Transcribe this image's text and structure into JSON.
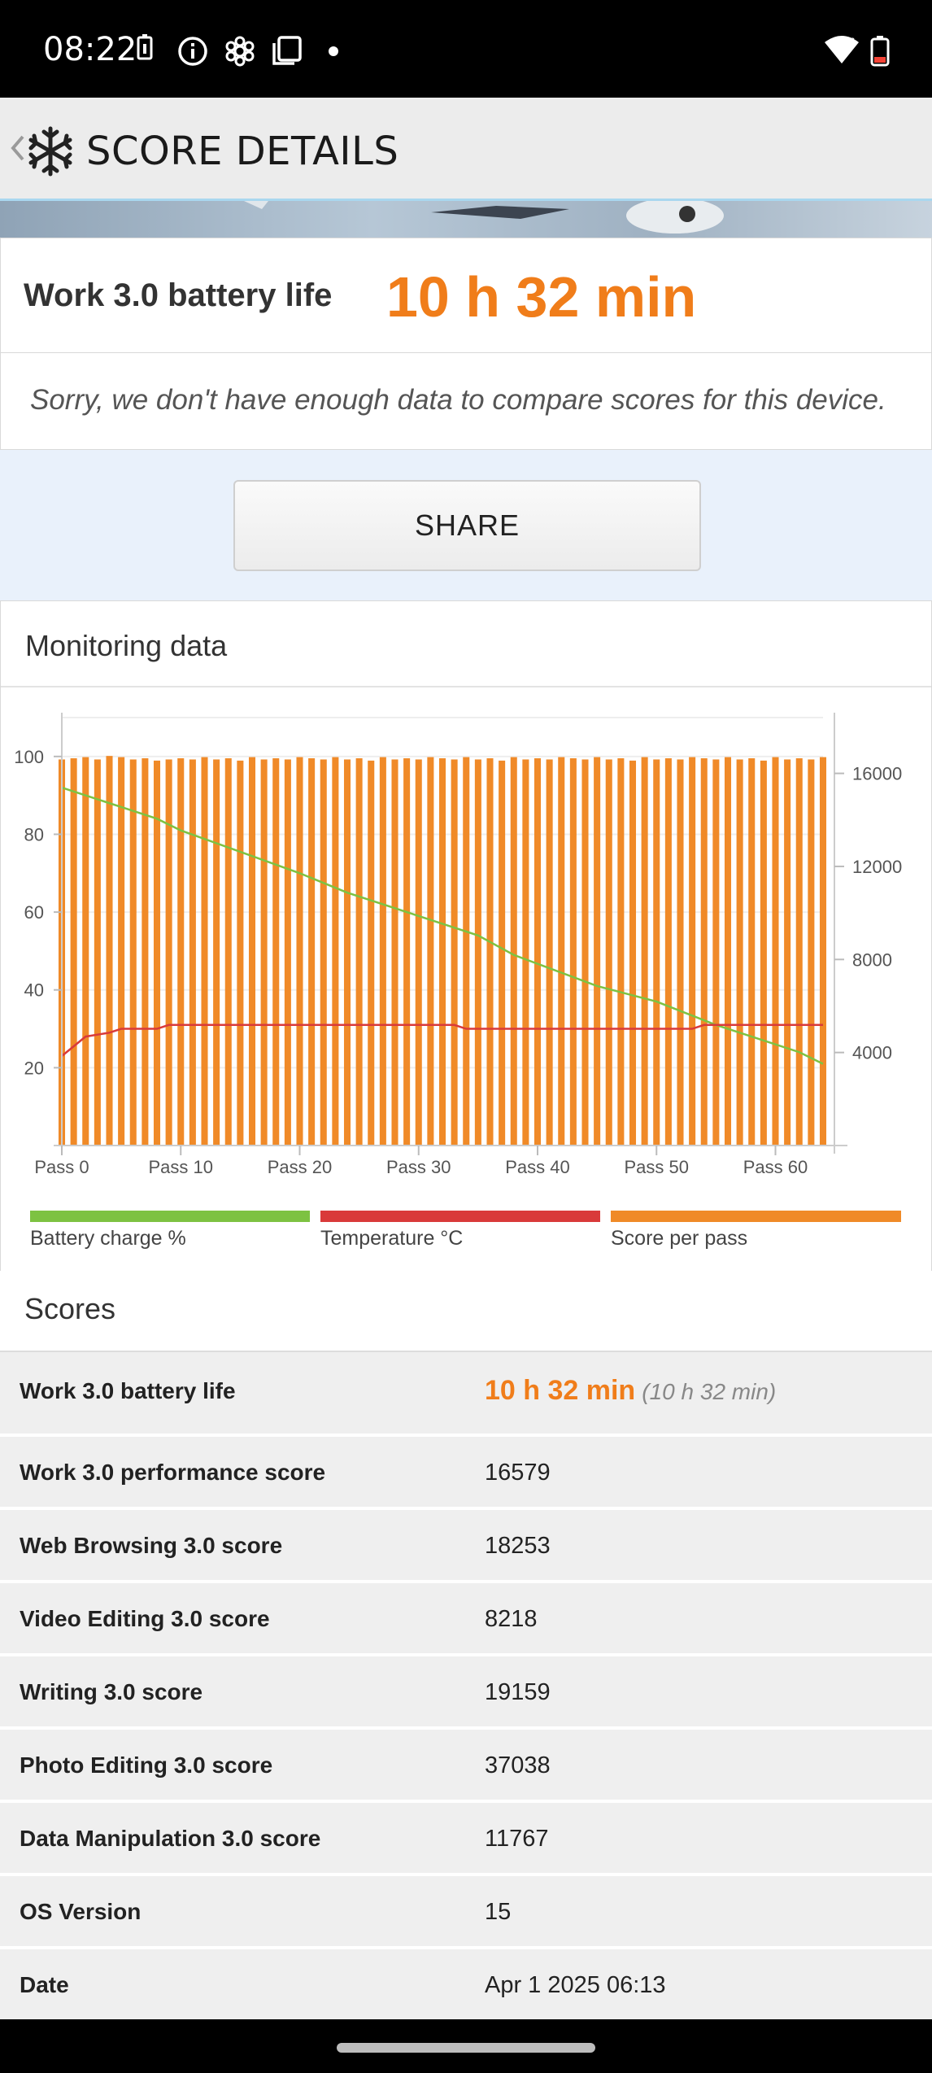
{
  "status_bar": {
    "time": "08:22"
  },
  "app_bar": {
    "title": "SCORE DETAILS"
  },
  "summary": {
    "label": "Work 3.0 battery life",
    "value": "10 h 32 min",
    "note": "Sorry, we don't have enough data to compare scores for this device."
  },
  "share_label": "SHARE",
  "monitoring": {
    "title": "Monitoring data",
    "legend": [
      {
        "label": "Battery charge %",
        "color": "#7dc242"
      },
      {
        "label": "Temperature °C",
        "color": "#d93a3a"
      },
      {
        "label": "Score per pass",
        "color": "#f08a28"
      }
    ]
  },
  "chart_data": {
    "type": "bar",
    "x_ticks": [
      "Pass 0",
      "Pass 10",
      "Pass 20",
      "Pass 30",
      "Pass 40",
      "Pass 50",
      "Pass 60"
    ],
    "left_axis": {
      "ticks": [
        20,
        40,
        60,
        80,
        100
      ],
      "range": [
        0,
        110
      ]
    },
    "right_axis": {
      "ticks": [
        4000,
        8000,
        12000,
        16000
      ],
      "range": [
        0,
        18400
      ]
    },
    "passes": 65,
    "score_per_pass": [
      16600,
      16650,
      16700,
      16600,
      16750,
      16700,
      16600,
      16650,
      16550,
      16600,
      16650,
      16600,
      16700,
      16600,
      16650,
      16550,
      16700,
      16600,
      16650,
      16600,
      16700,
      16650,
      16600,
      16700,
      16600,
      16650,
      16550,
      16700,
      16600,
      16650,
      16600,
      16700,
      16650,
      16600,
      16700,
      16600,
      16650,
      16550,
      16700,
      16600,
      16650,
      16600,
      16700,
      16650,
      16600,
      16700,
      16600,
      16650,
      16550,
      16700,
      16600,
      16650,
      16600,
      16700,
      16650,
      16600,
      16700,
      16600,
      16650,
      16550,
      16700,
      16600,
      16650,
      16600,
      16700
    ],
    "battery_points": [
      [
        0,
        92
      ],
      [
        5,
        87
      ],
      [
        8,
        84
      ],
      [
        10,
        81
      ],
      [
        20,
        70
      ],
      [
        24,
        65
      ],
      [
        35,
        54
      ],
      [
        38,
        49
      ],
      [
        45,
        41
      ],
      [
        50,
        37
      ],
      [
        55,
        31
      ],
      [
        62,
        24
      ],
      [
        64,
        21
      ]
    ],
    "temperature_points": [
      [
        0,
        23
      ],
      [
        2,
        28
      ],
      [
        4,
        29
      ],
      [
        5,
        30
      ],
      [
        8,
        30
      ],
      [
        9,
        31
      ],
      [
        33,
        31
      ],
      [
        34,
        30
      ],
      [
        53,
        30
      ],
      [
        54,
        31
      ],
      [
        64,
        31
      ]
    ]
  },
  "scores": {
    "title": "Scores",
    "rows": [
      {
        "label": "Work 3.0 battery life",
        "value": "10 h 32 min",
        "extra": "(10 h 32 min)"
      },
      {
        "label": "Work 3.0 performance score",
        "value": "16579"
      },
      {
        "label": "Web Browsing 3.0 score",
        "value": "18253"
      },
      {
        "label": "Video Editing 3.0 score",
        "value": "8218"
      },
      {
        "label": "Writing 3.0 score",
        "value": "19159"
      },
      {
        "label": "Photo Editing 3.0 score",
        "value": "37038"
      },
      {
        "label": "Data Manipulation 3.0 score",
        "value": "11767"
      },
      {
        "label": "OS Version",
        "value": "15"
      },
      {
        "label": "Date",
        "value": "Apr 1 2025 06:13"
      }
    ]
  }
}
